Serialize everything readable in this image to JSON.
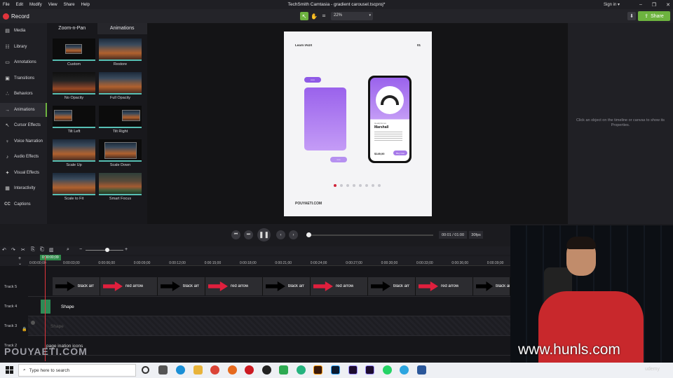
{
  "window": {
    "title": "TechSmith Camtasia - gradient carousel.tscproj*",
    "menu": [
      "File",
      "Edit",
      "Modify",
      "View",
      "Share",
      "Help"
    ],
    "sign_in": "Sign in ▾",
    "controls": [
      "–",
      "❐",
      "✕"
    ]
  },
  "toolbar": {
    "record_label": "Record",
    "zoom_value": "22%",
    "share_label": "Share"
  },
  "sidebar": {
    "items": [
      {
        "label": "Media",
        "icon": "media-icon"
      },
      {
        "label": "Library",
        "icon": "library-icon"
      },
      {
        "label": "Annotations",
        "icon": "annotations-icon"
      },
      {
        "label": "Transitions",
        "icon": "transitions-icon"
      },
      {
        "label": "Behaviors",
        "icon": "behaviors-icon"
      },
      {
        "label": "Animations",
        "icon": "animations-icon"
      },
      {
        "label": "Cursor Effects",
        "icon": "cursor-icon"
      },
      {
        "label": "Voice Narration",
        "icon": "mic-icon"
      },
      {
        "label": "Audio Effects",
        "icon": "audio-icon"
      },
      {
        "label": "Visual Effects",
        "icon": "visual-effects-icon"
      },
      {
        "label": "Interactivity",
        "icon": "interactivity-icon"
      },
      {
        "label": "Captions",
        "icon": "captions-icon"
      }
    ],
    "active_index": 5
  },
  "animations_panel": {
    "tabs": [
      "Zoom-n-Pan",
      "Animations"
    ],
    "active_tab": 1,
    "tiles": [
      "Custom",
      "Restore",
      "No Opacity",
      "Full Opacity",
      "Tilt Left",
      "Tilt Right",
      "Scale Up",
      "Scale Down",
      "Scale to Fit",
      "Smart Focus"
    ]
  },
  "canvas": {
    "page_header_left": "Learn IAUX",
    "page_header_right": "01",
    "badge_top": "••••••",
    "badge_bottom": "•••••",
    "phone_product_tag": "Headphones",
    "phone_product_name": "Marshall",
    "phone_product_price": "$149,00",
    "phone_button": "Buy now",
    "footer_brand": "POUYAETI.COM",
    "pager_dots": 8,
    "pager_active": 0
  },
  "properties": {
    "message": "Click an object on the timeline or canvas to show its Properties."
  },
  "playback": {
    "time": "00:01 / 01:00",
    "fps": "30fps",
    "progress": 0.017
  },
  "timeline": {
    "playhead_time": "0:00:00;09",
    "ruler_start": "0:00:00;00",
    "ruler_ticks": [
      "0:00:03;00",
      "0:00:06;00",
      "0:00:09;00",
      "0:00:12;00",
      "0:00:15;00",
      "0:00:18;00",
      "0:00:21;00",
      "0:00:24;00",
      "0:00:27;00",
      "0:00:30;00",
      "0:00:33;00",
      "0:00:36;00",
      "0:00:39;00"
    ],
    "tracks": [
      {
        "name": "Track 5",
        "clips": [
          "black arr",
          "red arrow",
          "black arr",
          "red arrow",
          "black arr",
          "red arrow",
          "black arr",
          "red arrow",
          "black arr"
        ]
      },
      {
        "name": "Track 4",
        "clips": [
          "Shape"
        ]
      },
      {
        "name": "Track 3",
        "clips": [
          "Shape"
        ]
      },
      {
        "name": "Track 2",
        "clips": [
          "page ination icons"
        ]
      }
    ]
  },
  "taskbar": {
    "search_placeholder": "Type here to search"
  },
  "overlay": {
    "watermark": "POUYAETI.COM",
    "site": "www.hunls.com",
    "udemy": "udemy"
  }
}
